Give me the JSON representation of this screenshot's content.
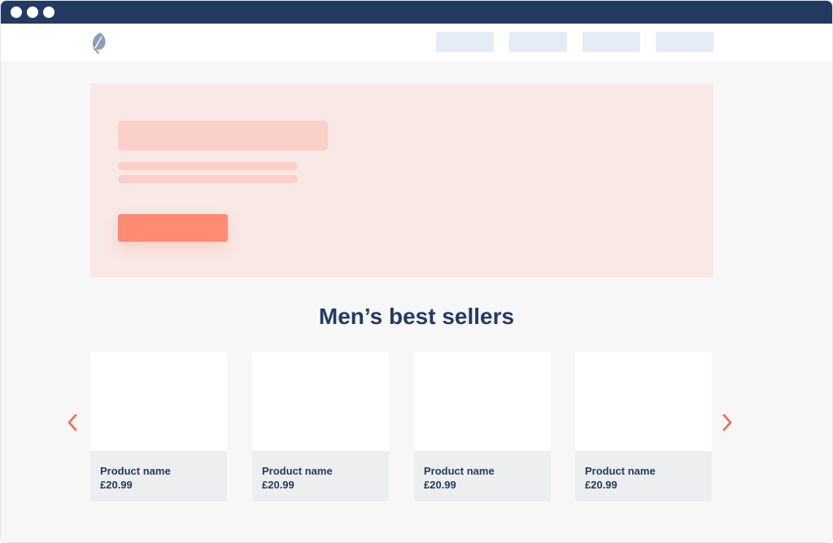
{
  "browser": {
    "window_dots": [
      "close",
      "minimize",
      "maximize"
    ],
    "titlebar_color": "#233a63"
  },
  "header": {
    "logo_icon": "leaf-icon",
    "nav_items": [
      "",
      "",
      "",
      ""
    ]
  },
  "hero": {
    "background_color": "#f8e8e6",
    "placeholder_color": "#fbd0c8",
    "cta_color": "#ff8b73"
  },
  "section": {
    "title": "Men’s best sellers"
  },
  "carousel": {
    "prev_icon": "chevron-left-icon",
    "next_icon": "chevron-right-icon",
    "arrow_color": "#f26b4d",
    "products": [
      {
        "name": "Product name",
        "price": "£20.99"
      },
      {
        "name": "Product name",
        "price": "£20.99"
      },
      {
        "name": "Product name",
        "price": "£20.99"
      },
      {
        "name": "Product name",
        "price": "£20.99"
      }
    ]
  }
}
